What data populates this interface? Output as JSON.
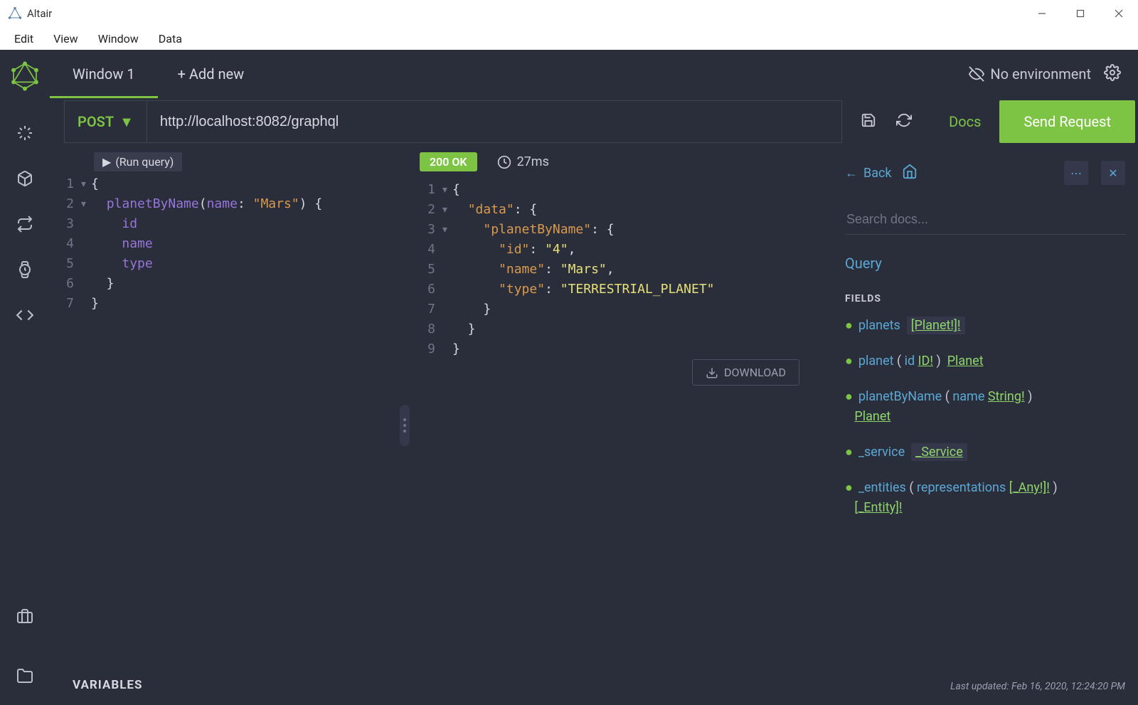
{
  "titlebar": {
    "title": "Altair"
  },
  "menubar": {
    "items": [
      "Edit",
      "View",
      "Window",
      "Data"
    ]
  },
  "tabs": {
    "active": "Window 1",
    "add": "+ Add new"
  },
  "environment": {
    "label": "No environment"
  },
  "request": {
    "method": "POST",
    "url": "http://localhost:8082/graphql",
    "docs": "Docs",
    "send": "Send Request"
  },
  "query": {
    "run_label": "(Run query)",
    "lines": [
      {
        "n": "1",
        "fold": "▾",
        "tokens": [
          {
            "t": "{",
            "c": "plain"
          }
        ]
      },
      {
        "n": "2",
        "fold": "▾",
        "tokens": [
          {
            "t": "  ",
            "c": "plain"
          },
          {
            "t": "planetByName",
            "c": "purple"
          },
          {
            "t": "(",
            "c": "plain"
          },
          {
            "t": "name",
            "c": "purple"
          },
          {
            "t": ": ",
            "c": "plain"
          },
          {
            "t": "\"Mars\"",
            "c": "orange"
          },
          {
            "t": ") {",
            "c": "plain"
          }
        ]
      },
      {
        "n": "3",
        "fold": "",
        "tokens": [
          {
            "t": "    ",
            "c": "plain"
          },
          {
            "t": "id",
            "c": "purple"
          }
        ]
      },
      {
        "n": "4",
        "fold": "",
        "tokens": [
          {
            "t": "    ",
            "c": "plain"
          },
          {
            "t": "name",
            "c": "purple"
          }
        ]
      },
      {
        "n": "5",
        "fold": "",
        "tokens": [
          {
            "t": "    ",
            "c": "plain"
          },
          {
            "t": "type",
            "c": "purple"
          }
        ]
      },
      {
        "n": "6",
        "fold": "",
        "tokens": [
          {
            "t": "  }",
            "c": "plain"
          }
        ]
      },
      {
        "n": "7",
        "fold": "",
        "tokens": [
          {
            "t": "}",
            "c": "plain"
          }
        ]
      }
    ],
    "variables_label": "VARIABLES"
  },
  "response": {
    "status": "200 OK",
    "time": "27ms",
    "download": "DOWNLOAD",
    "lines": [
      {
        "n": "1",
        "fold": "▾",
        "tokens": [
          {
            "t": "{",
            "c": "plain"
          }
        ]
      },
      {
        "n": "2",
        "fold": "▾",
        "tokens": [
          {
            "t": "  ",
            "c": "plain"
          },
          {
            "t": "\"data\"",
            "c": "orange"
          },
          {
            "t": ": {",
            "c": "plain"
          }
        ]
      },
      {
        "n": "3",
        "fold": "▾",
        "tokens": [
          {
            "t": "    ",
            "c": "plain"
          },
          {
            "t": "\"planetByName\"",
            "c": "orange"
          },
          {
            "t": ": {",
            "c": "plain"
          }
        ]
      },
      {
        "n": "4",
        "fold": "",
        "tokens": [
          {
            "t": "      ",
            "c": "plain"
          },
          {
            "t": "\"id\"",
            "c": "orange"
          },
          {
            "t": ": ",
            "c": "plain"
          },
          {
            "t": "\"4\"",
            "c": "yellow"
          },
          {
            "t": ",",
            "c": "plain"
          }
        ]
      },
      {
        "n": "5",
        "fold": "",
        "tokens": [
          {
            "t": "      ",
            "c": "plain"
          },
          {
            "t": "\"name\"",
            "c": "orange"
          },
          {
            "t": ": ",
            "c": "plain"
          },
          {
            "t": "\"Mars\"",
            "c": "yellow"
          },
          {
            "t": ",",
            "c": "plain"
          }
        ]
      },
      {
        "n": "6",
        "fold": "",
        "tokens": [
          {
            "t": "      ",
            "c": "plain"
          },
          {
            "t": "\"type\"",
            "c": "orange"
          },
          {
            "t": ": ",
            "c": "plain"
          },
          {
            "t": "\"TERRESTRIAL_PLANET\"",
            "c": "yellow"
          }
        ]
      },
      {
        "n": "7",
        "fold": "",
        "tokens": [
          {
            "t": "    }",
            "c": "plain"
          }
        ]
      },
      {
        "n": "8",
        "fold": "",
        "tokens": [
          {
            "t": "  }",
            "c": "plain"
          }
        ]
      },
      {
        "n": "9",
        "fold": "",
        "tokens": [
          {
            "t": "}",
            "c": "plain"
          }
        ]
      }
    ]
  },
  "docs": {
    "back": "Back",
    "search_placeholder": "Search docs...",
    "type": "Query",
    "section": "FIELDS",
    "fields": [
      {
        "name": "planets",
        "args": [],
        "return": "[Planet!]!",
        "boxed": true
      },
      {
        "name": "planet",
        "args": [
          {
            "name": "id",
            "type": "ID!"
          }
        ],
        "return": "Planet",
        "boxed": false
      },
      {
        "name": "planetByName",
        "args": [
          {
            "name": "name",
            "type": "String!"
          }
        ],
        "return": "Planet",
        "boxed": false,
        "wrap": true
      },
      {
        "name": "_service",
        "args": [],
        "return": "_Service",
        "boxed": true
      },
      {
        "name": "_entities",
        "args": [
          {
            "name": "representations",
            "type": "[_Any!]!"
          }
        ],
        "return": "[_Entity]!",
        "boxed": false,
        "wrap": true
      }
    ],
    "footer": "Last updated: Feb 16, 2020, 12:24:20 PM"
  }
}
